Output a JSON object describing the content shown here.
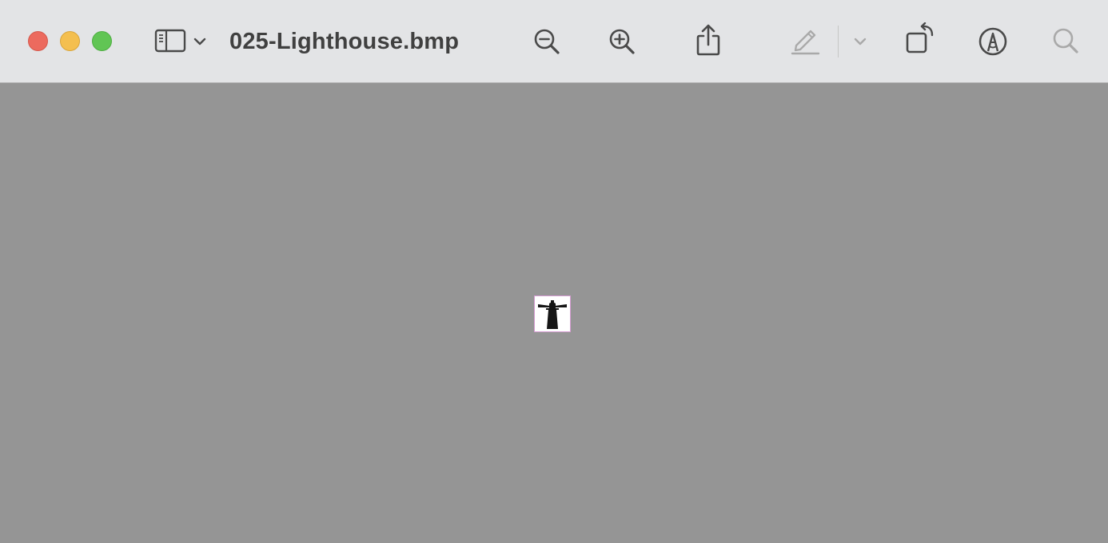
{
  "window": {
    "title": "025-Lighthouse.bmp"
  },
  "toolbar": {
    "buttons": [
      {
        "name": "sidebar-toggle",
        "icon": "sidebar-icon"
      },
      {
        "name": "sidebar-menu",
        "icon": "chevron-down-icon"
      },
      {
        "name": "zoom-out",
        "icon": "zoom-out-icon"
      },
      {
        "name": "zoom-in",
        "icon": "zoom-in-icon"
      },
      {
        "name": "share",
        "icon": "share-icon"
      },
      {
        "name": "highlight",
        "icon": "pencil-icon",
        "enabled": false
      },
      {
        "name": "highlight-menu",
        "icon": "chevron-down-icon",
        "enabled": false
      },
      {
        "name": "rotate",
        "icon": "rotate-icon"
      },
      {
        "name": "markup",
        "icon": "markup-icon"
      },
      {
        "name": "search",
        "icon": "search-icon",
        "enabled": false
      }
    ]
  },
  "document": {
    "image_subject": "lighthouse-icon"
  },
  "colors": {
    "close": "#ec6a5e",
    "minimize": "#f4bf4f",
    "zoom": "#61c554",
    "toolbar_bg": "#e3e4e6",
    "canvas_bg": "#959595",
    "icon": "#4a4a4a",
    "icon_disabled": "#a9a9a9"
  }
}
